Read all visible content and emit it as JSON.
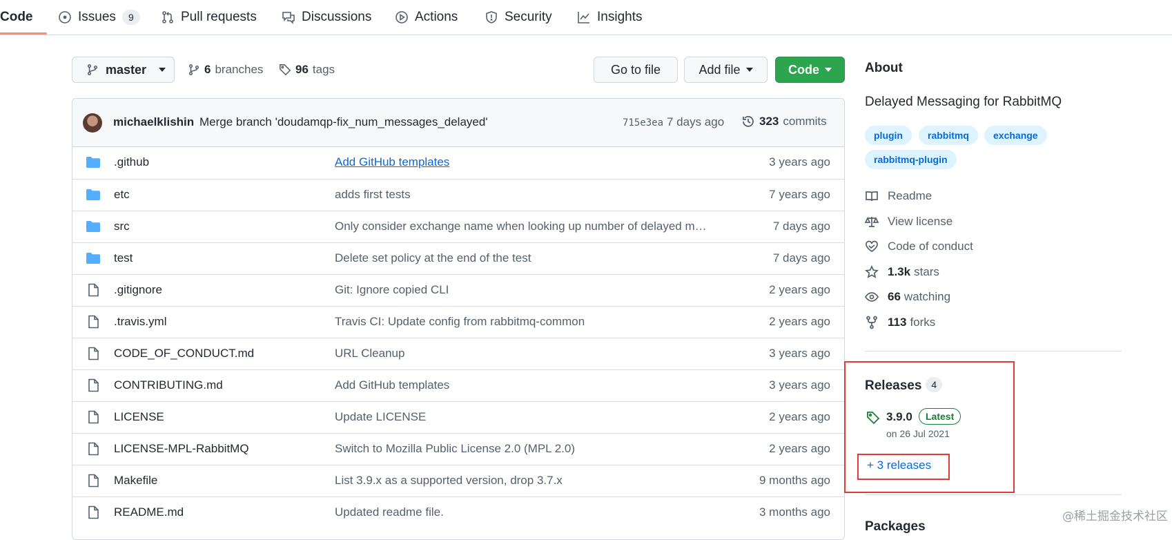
{
  "nav": {
    "tabs": [
      {
        "label": "Code",
        "icon": "code-icon"
      },
      {
        "label": "Issues",
        "count": "9",
        "icon": "issue-opened-icon"
      },
      {
        "label": "Pull requests",
        "icon": "git-pull-request-icon"
      },
      {
        "label": "Discussions",
        "icon": "comment-discussion-icon"
      },
      {
        "label": "Actions",
        "icon": "play-icon"
      },
      {
        "label": "Security",
        "icon": "shield-icon"
      },
      {
        "label": "Insights",
        "icon": "graph-icon"
      }
    ]
  },
  "toolbar": {
    "branch": "master",
    "branches_count": "6",
    "branches_label": "branches",
    "tags_count": "96",
    "tags_label": "tags",
    "go_to_file": "Go to file",
    "add_file": "Add file",
    "code": "Code"
  },
  "commit": {
    "author": "michaelklishin",
    "message": "Merge branch 'doudamqp-fix_num_messages_delayed'",
    "sha": "715e3ea",
    "age": "7 days ago",
    "count": "323",
    "count_label": "commits"
  },
  "files": [
    {
      "type": "dir",
      "name": ".github",
      "message": "Add GitHub templates",
      "age": "3 years ago",
      "link": true
    },
    {
      "type": "dir",
      "name": "etc",
      "message": "adds first tests",
      "age": "7 years ago"
    },
    {
      "type": "dir",
      "name": "src",
      "message": "Only consider exchange name when looking up number of delayed m…",
      "age": "7 days ago"
    },
    {
      "type": "dir",
      "name": "test",
      "message": "Delete set policy at the end of the test",
      "age": "7 days ago"
    },
    {
      "type": "file",
      "name": ".gitignore",
      "message": "Git: Ignore copied CLI",
      "age": "2 years ago"
    },
    {
      "type": "file",
      "name": ".travis.yml",
      "message": "Travis CI: Update config from rabbitmq-common",
      "age": "2 years ago"
    },
    {
      "type": "file",
      "name": "CODE_OF_CONDUCT.md",
      "message": "URL Cleanup",
      "age": "3 years ago"
    },
    {
      "type": "file",
      "name": "CONTRIBUTING.md",
      "message": "Add GitHub templates",
      "age": "3 years ago"
    },
    {
      "type": "file",
      "name": "LICENSE",
      "message": "Update LICENSE",
      "age": "2 years ago"
    },
    {
      "type": "file",
      "name": "LICENSE-MPL-RabbitMQ",
      "message": "Switch to Mozilla Public License 2.0 (MPL 2.0)",
      "age": "2 years ago"
    },
    {
      "type": "file",
      "name": "Makefile",
      "message": "List 3.9.x as a supported version, drop 3.7.x",
      "age": "9 months ago"
    },
    {
      "type": "file",
      "name": "README.md",
      "message": "Updated readme file.",
      "age": "3 months ago"
    }
  ],
  "about": {
    "heading": "About",
    "description": "Delayed Messaging for RabbitMQ",
    "topics": [
      "plugin",
      "rabbitmq",
      "exchange",
      "rabbitmq-plugin"
    ],
    "readme": "Readme",
    "license": "View license",
    "conduct": "Code of conduct",
    "stars_count": "1.3k",
    "stars_label": "stars",
    "watching_count": "66",
    "watching_label": "watching",
    "forks_count": "113",
    "forks_label": "forks"
  },
  "releases": {
    "heading": "Releases",
    "count": "4",
    "latest_version": "3.9.0",
    "latest_badge": "Latest",
    "latest_date": "on 26 Jul 2021",
    "more_link": "+ 3 releases"
  },
  "packages": {
    "heading": "Packages"
  },
  "watermark": "@稀土掘金技术社区",
  "colors": {
    "accent": "#0969da",
    "primary_button": "#2da44e",
    "highlight_box": "#e53935",
    "active_tab_underline": "#fd8c73"
  }
}
